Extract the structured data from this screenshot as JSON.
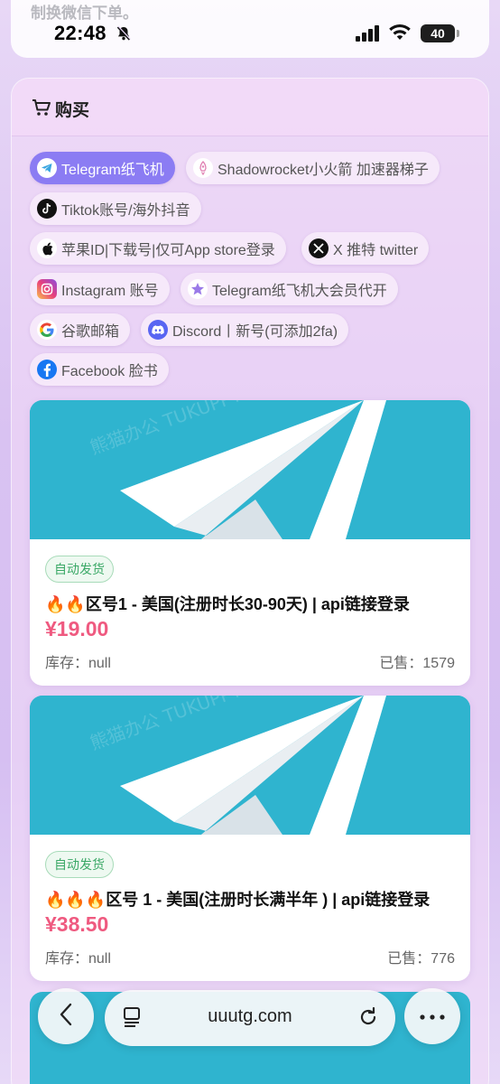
{
  "status_bar": {
    "time": "22:48",
    "battery": "40"
  },
  "top_banner": {
    "text": "制换微信下单。"
  },
  "panel": {
    "title": "购买"
  },
  "categories": [
    {
      "label": "Telegram纸飞机",
      "icon": "telegram-icon",
      "active": true
    },
    {
      "label": "Shadowrocket小火箭 加速器梯子",
      "icon": "rocket-icon",
      "active": false
    },
    {
      "label": "Tiktok账号/海外抖音",
      "icon": "tiktok-icon",
      "active": false
    },
    {
      "label": "苹果ID|下载号|仅可App store登录",
      "icon": "apple-icon",
      "active": false
    },
    {
      "label": "X 推特 twitter",
      "icon": "x-icon",
      "active": false
    },
    {
      "label": "Instagram 账号",
      "icon": "instagram-icon",
      "active": false
    },
    {
      "label": "Telegram纸飞机大会员代开",
      "icon": "star-icon",
      "active": false
    },
    {
      "label": "谷歌邮箱",
      "icon": "google-icon",
      "active": false
    },
    {
      "label": "Discord丨新号(可添加2fa)",
      "icon": "discord-icon",
      "active": false
    },
    {
      "label": "Facebook 脸书",
      "icon": "facebook-icon",
      "active": false
    }
  ],
  "products": [
    {
      "badge": "自动发货",
      "title": "🔥🔥区号1 - 美国(注册时长30-90天) | api链接登录",
      "price": "¥19.00",
      "stock": "库存：null",
      "sold": "已售：1579",
      "watermark": "熊猫办公 TUKUPPT"
    },
    {
      "badge": "自动发货",
      "title": "🔥🔥🔥区号 1 - 美国(注册时长满半年 ) | api链接登录",
      "price": "¥38.50",
      "stock": "库存：null",
      "sold": "已售：776",
      "watermark": "熊猫办公 TUKUPPT"
    }
  ],
  "browser": {
    "url": "uuutg.com"
  },
  "colors": {
    "accent": "#8b7cf3",
    "price": "#ef5a80",
    "badge_green": "#3aa866",
    "telegram_blue": "#2fb4cf"
  }
}
